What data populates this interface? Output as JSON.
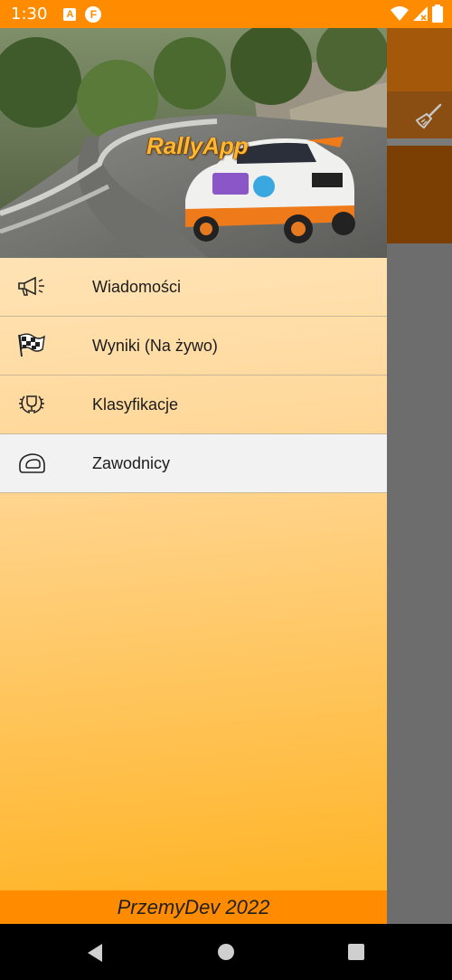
{
  "status_bar": {
    "time": "1:30",
    "notif_a": "A",
    "notif_f": "F"
  },
  "drawer": {
    "app_title": "RallyApp",
    "menu": [
      {
        "label": "Wiadomości",
        "icon": "megaphone-icon"
      },
      {
        "label": "Wyniki (Na żywo)",
        "icon": "checkered-flag-icon"
      },
      {
        "label": "Klasyfikacje",
        "icon": "trophy-laurel-icon"
      },
      {
        "label": "Zawodnicy",
        "icon": "helmet-icon",
        "selected": true
      }
    ],
    "footer": "PrzemyDev 2022"
  },
  "colors": {
    "status_bar": "#ff8c00",
    "footer": "#ff8c00",
    "drawer_gradient_end": "#ffb21f"
  }
}
